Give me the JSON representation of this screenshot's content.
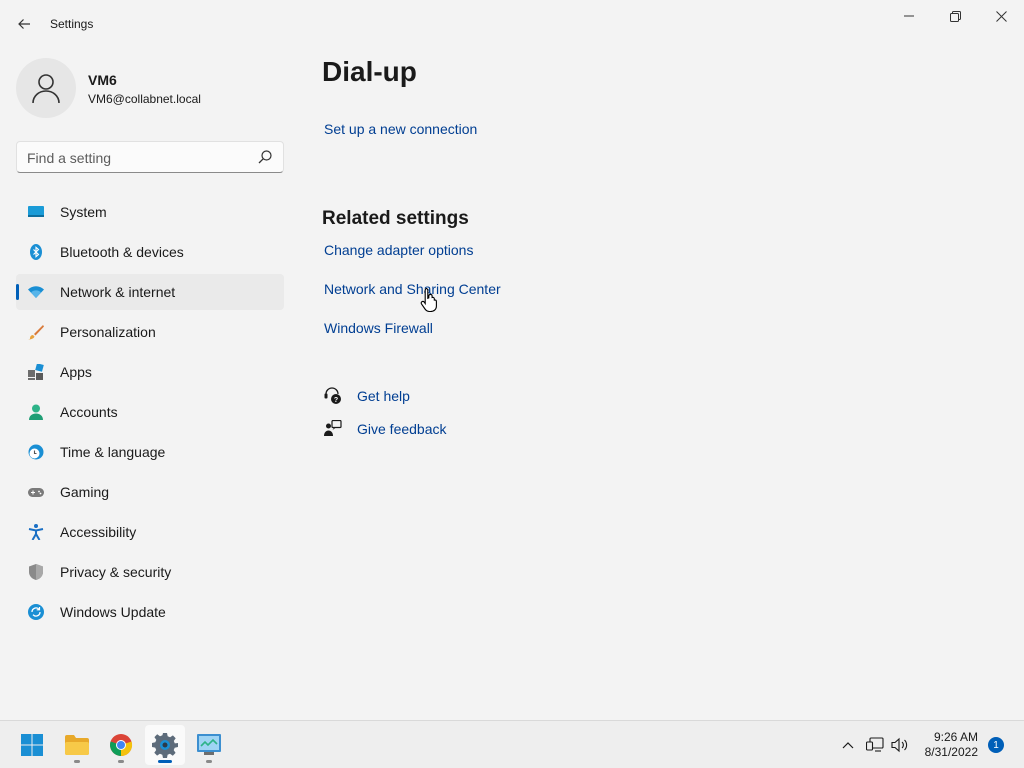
{
  "window": {
    "title": "Settings",
    "back_icon": "back-arrow-icon",
    "controls": [
      "minimize-icon",
      "restore-icon",
      "close-icon"
    ]
  },
  "profile": {
    "name": "VM6",
    "email": "VM6@collabnet.local",
    "avatar_icon": "person-icon"
  },
  "search": {
    "placeholder": "Find a setting",
    "value": "",
    "icon": "search-icon"
  },
  "nav": {
    "items": [
      {
        "label": "System",
        "icon": "system-icon",
        "active": false
      },
      {
        "label": "Bluetooth & devices",
        "icon": "bluetooth-icon",
        "active": false
      },
      {
        "label": "Network & internet",
        "icon": "wifi-icon",
        "active": true
      },
      {
        "label": "Personalization",
        "icon": "brush-icon",
        "active": false
      },
      {
        "label": "Apps",
        "icon": "apps-icon",
        "active": false
      },
      {
        "label": "Accounts",
        "icon": "accounts-icon",
        "active": false
      },
      {
        "label": "Time & language",
        "icon": "clock-globe-icon",
        "active": false
      },
      {
        "label": "Gaming",
        "icon": "gamepad-icon",
        "active": false
      },
      {
        "label": "Accessibility",
        "icon": "accessibility-icon",
        "active": false
      },
      {
        "label": "Privacy & security",
        "icon": "shield-icon",
        "active": false
      },
      {
        "label": "Windows Update",
        "icon": "update-icon",
        "active": false
      }
    ]
  },
  "main": {
    "title": "Dial-up",
    "setup_link": "Set up a new connection",
    "related_title": "Related settings",
    "related_links": [
      "Change adapter options",
      "Network and Sharing Center",
      "Windows Firewall"
    ],
    "help": {
      "get_help": "Get help",
      "give_feedback": "Give feedback"
    }
  },
  "taskbar": {
    "apps": [
      "start-icon",
      "file-explorer-icon",
      "chrome-icon",
      "settings-icon",
      "control-panel-icon"
    ],
    "active_app": "settings-icon",
    "tray_icons": [
      "chevron-up-icon",
      "network-icon",
      "volume-icon"
    ],
    "time": "9:26 AM",
    "date": "8/31/2022",
    "notification_count": "1"
  },
  "colors": {
    "background": "#f3f3f3",
    "link": "#003e92",
    "accent": "#005fb8",
    "active_nav": "#eaeaea"
  }
}
